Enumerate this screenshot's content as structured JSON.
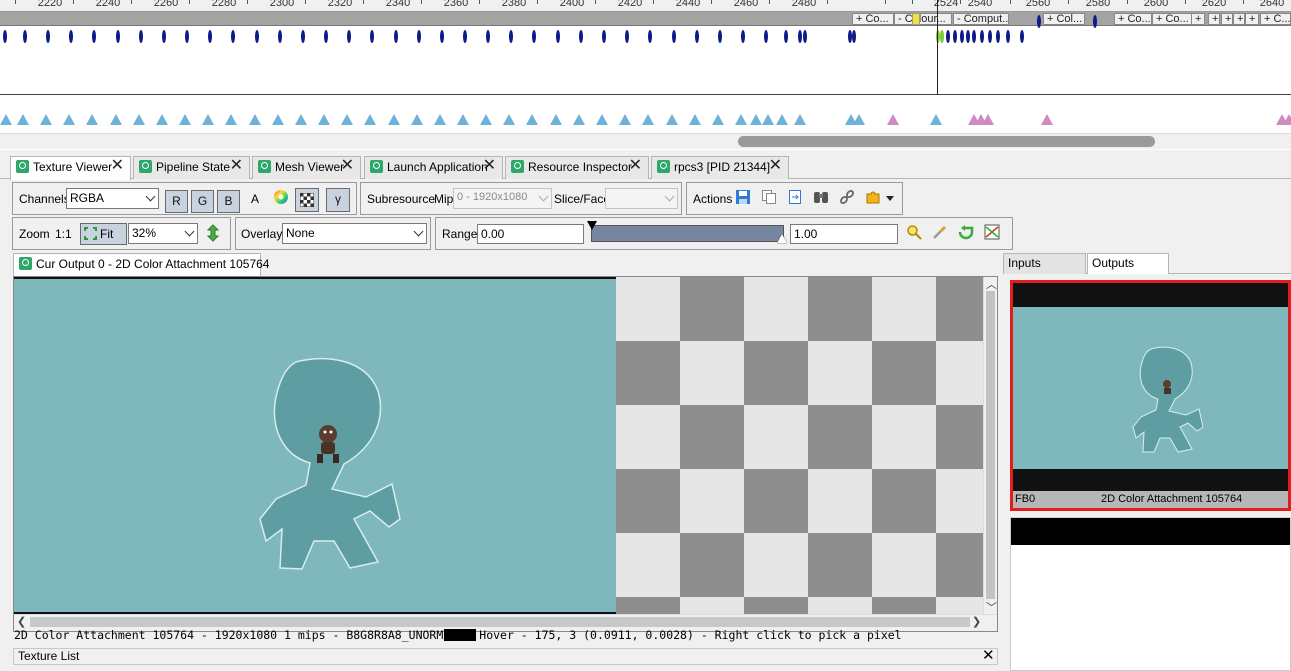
{
  "timeline": {
    "ruler_ticks": [
      "2220",
      "2240",
      "2260",
      "2280",
      "2300",
      "2320",
      "2340",
      "2360",
      "2380",
      "2400",
      "2420",
      "2440",
      "2460",
      "2480",
      "2524",
      "2540",
      "2560",
      "2580",
      "2600",
      "2620",
      "2640"
    ],
    "markers": [
      "+ Co...",
      "- Colour...",
      "- Comput...",
      "+ Col...",
      "+ Co...",
      "+ Co...",
      "+",
      "+",
      "+",
      "+",
      "+",
      "+ C..."
    ]
  },
  "tabs": [
    {
      "label": "Texture Viewer",
      "close": "✕"
    },
    {
      "label": "Pipeline State",
      "close": "✕"
    },
    {
      "label": "Mesh Viewer",
      "close": "✕"
    },
    {
      "label": "Launch Application",
      "close": "✕"
    },
    {
      "label": "Resource Inspector",
      "close": "✕"
    },
    {
      "label": "rpcs3 [PID 21344]",
      "close": "✕"
    }
  ],
  "toolbar1": {
    "channels_label": "Channels",
    "channels_value": "RGBA",
    "r": "R",
    "g": "G",
    "b": "B",
    "a": "A",
    "gamma": "γ",
    "subresource_label": "Subresource",
    "mip_label": "Mip",
    "mip_value": "0 - 1920x1080",
    "slice_label": "Slice/Face",
    "slice_value": "",
    "actions_label": "Actions"
  },
  "toolbar2": {
    "zoom_label": "Zoom",
    "one_to_one": "1:1",
    "fit_label": "Fit",
    "zoom_value": "32%",
    "overlay_label": "Overlay",
    "overlay_value": "None",
    "range_label": "Range",
    "range_min": "0.00",
    "range_max": "1.00"
  },
  "document_tab": "Cur Output 0 - 2D Color Attachment 105764",
  "status": {
    "info": "2D Color Attachment 105764 - 1920x1080 1 mips - B8G8R8A8_UNORM",
    "hover": "Hover -   175,    3 (0.0911, 0.0028)  - Right click to pick a pixel"
  },
  "texture_list_label": "Texture List",
  "texture_list_close": "✕",
  "io": {
    "inputs_tab": "Inputs",
    "outputs_tab": "Outputs",
    "thumb_slot": "FB0",
    "thumb_name": "2D Color Attachment 105764"
  },
  "colors": {
    "render_bg": "#7fb8bc",
    "character": "#5e9da1",
    "selected_border": "#e01e1e",
    "event_marker": "#0c1a8a"
  }
}
